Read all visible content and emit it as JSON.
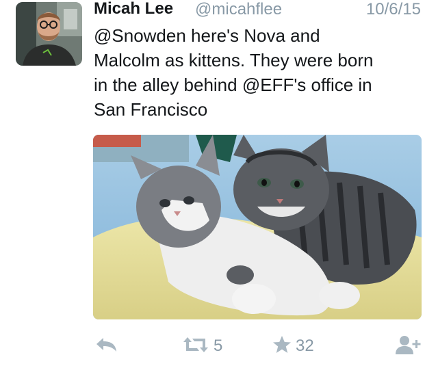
{
  "tweet": {
    "author_name": "Micah Lee",
    "author_handle": "@micahflee",
    "date": "10/6/15",
    "text_lines": [
      "@Snowden here's Nova and",
      "Malcolm as kittens. They were born",
      "in the alley behind @EFF's office in",
      "San Francisco"
    ]
  },
  "actions": {
    "retweet_count": "5",
    "like_count": "32"
  },
  "icons": {
    "reply": "reply-icon",
    "retweet": "retweet-icon",
    "like": "star-icon",
    "follow": "add-user-icon"
  },
  "colors": {
    "text": "#14171a",
    "muted": "#8899a6",
    "icon": "#aab8c2"
  }
}
